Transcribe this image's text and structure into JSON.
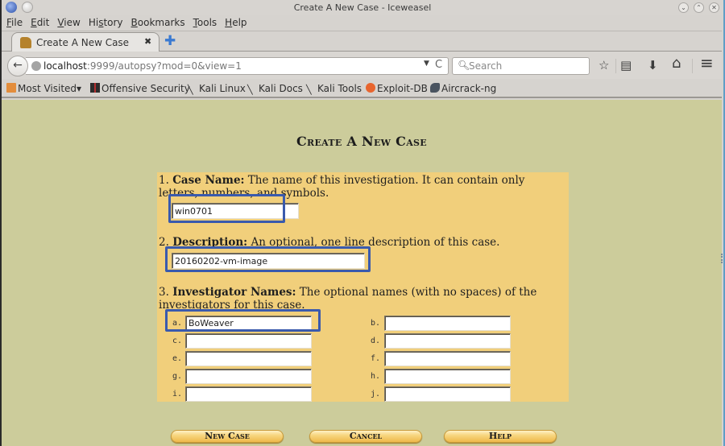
{
  "window": {
    "title": "Create A New Case - Iceweasel",
    "controls": {
      "minimize": "⌄",
      "maximize": "⌃",
      "close": "✕"
    }
  },
  "menu": [
    "File",
    "Edit",
    "View",
    "History",
    "Bookmarks",
    "Tools",
    "Help"
  ],
  "menu_mnemonics": [
    "F",
    "E",
    "V",
    "s",
    "B",
    "T",
    "H"
  ],
  "tab": {
    "title": "Create A New Case",
    "close": "✖",
    "new_tab": "✚"
  },
  "nav": {
    "url_host": "localhost",
    "url_rest": ":9999/autopsy?mod=0&view=1",
    "search_placeholder": "Search",
    "icons": {
      "back": "🡐",
      "reload": "C",
      "dropdown": "▼",
      "search": "⚲",
      "bookmark_star": "☆",
      "reading_list": "▤",
      "download": "⬇",
      "home": "⌂",
      "menu": "≡"
    }
  },
  "bookmarks": [
    {
      "label": "Most Visited",
      "icon": "folder-icon",
      "dropdown": "▾"
    },
    {
      "label": "Offensive Security",
      "icon": "offsec-icon"
    },
    {
      "label": "Kali Linux",
      "icon": "kali-dragon-icon"
    },
    {
      "label": "Kali Docs",
      "icon": "kali-dragon-icon"
    },
    {
      "label": "Kali Tools",
      "icon": "kali-dragon-icon"
    },
    {
      "label": "Exploit-DB",
      "icon": "exploit-db-icon"
    },
    {
      "label": "Aircrack-ng",
      "icon": "aircrack-icon"
    }
  ],
  "page": {
    "title": "Create A New Case",
    "case_name": {
      "number": "1.",
      "label": "Case Name:",
      "help": " The name of this investigation. It can contain only letters, numbers, and symbols.",
      "value": "win0701"
    },
    "description": {
      "number": "2.",
      "label": "Description:",
      "help": " An optional, one line description of this case.",
      "value": "20160202-vm-image"
    },
    "investigators": {
      "number": "3.",
      "label": "Investigator Names:",
      "help": " The optional names (with no spaces) of the investigators for this case.",
      "fields": [
        {
          "label": "a.",
          "value": "BoWeaver"
        },
        {
          "label": "b.",
          "value": ""
        },
        {
          "label": "c.",
          "value": ""
        },
        {
          "label": "d.",
          "value": ""
        },
        {
          "label": "e.",
          "value": ""
        },
        {
          "label": "f.",
          "value": ""
        },
        {
          "label": "g.",
          "value": ""
        },
        {
          "label": "h.",
          "value": ""
        },
        {
          "label": "i.",
          "value": ""
        },
        {
          "label": "j.",
          "value": ""
        }
      ]
    },
    "buttons": {
      "new_case": "New Case",
      "cancel": "Cancel",
      "help": "Help"
    }
  },
  "colors": {
    "page_bg": "#cccc9b",
    "form_bg": "#f1cf7b",
    "highlight": "#3a5aad",
    "button": "#f7d680"
  }
}
